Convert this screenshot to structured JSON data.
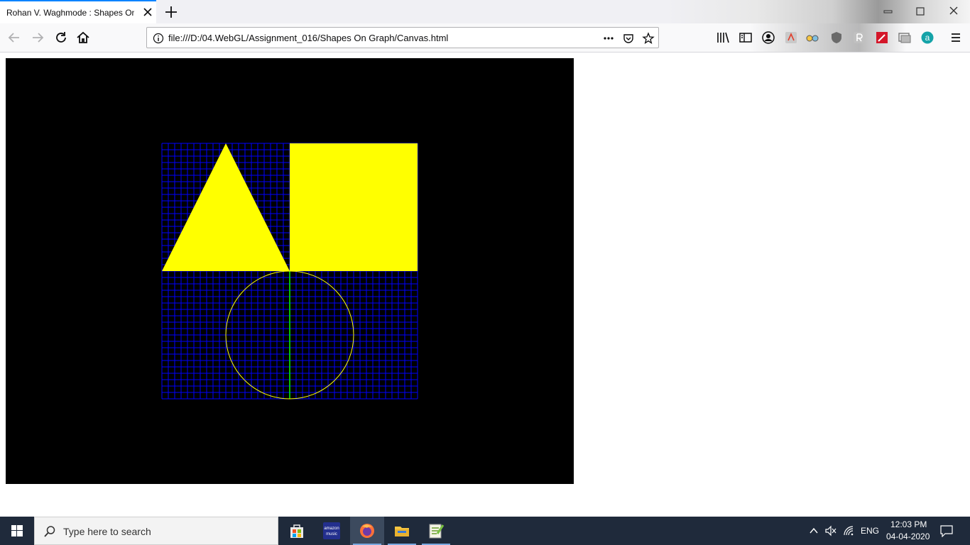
{
  "browser": {
    "tab_title": "Rohan V. Waghmode : Shapes On Graph",
    "url": "file:///D:/04.WebGL/Assignment_016/Shapes On Graph/Canvas.html"
  },
  "canvas": {
    "background": "#000000",
    "grid_color": "#0000ff",
    "axis_color": "#00ff00",
    "shape_color": "#ffff00",
    "shapes": [
      "filled-triangle",
      "filled-square",
      "circle-outline"
    ]
  },
  "taskbar": {
    "search_placeholder": "Type here to search",
    "apps": [
      "microsoft-store",
      "amazon-music",
      "firefox",
      "file-explorer",
      "notepad-plus-plus"
    ],
    "amazon_label_1": "amazon",
    "amazon_label_2": "music",
    "language": "ENG",
    "time": "12:03 PM",
    "date": "04-04-2020"
  },
  "colors": {
    "accent": "#0a84ff",
    "taskbar_bg": "#1f2a3b"
  }
}
